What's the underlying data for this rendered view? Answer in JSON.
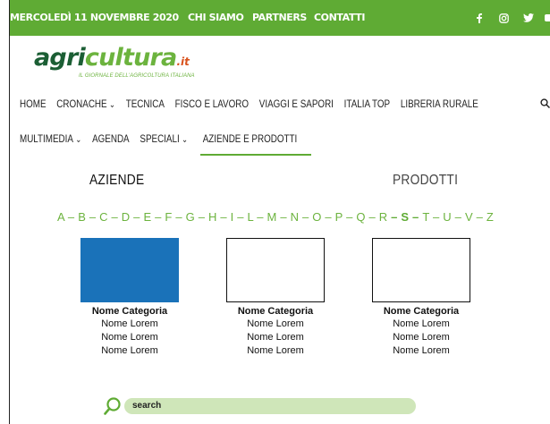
{
  "topbar": {
    "date": "MERCOLEDÌ 11 NOVEMBRE 2020",
    "links": [
      "CHI SIAMO",
      "PARTNERS",
      "CONTATTI"
    ],
    "social_icons": [
      "facebook-icon",
      "instagram-icon",
      "twitter-icon",
      "youtube-icon"
    ],
    "background": "#5fab34"
  },
  "logo": {
    "word_part1": "agri",
    "word_part2": "cultura",
    "suffix": ".it",
    "tagline": "IL GIORNALE DELL'AGRICOLTURA ITALIANA"
  },
  "nav": {
    "row1": [
      {
        "label": "HOME",
        "dropdown": false
      },
      {
        "label": "CRONACHE",
        "dropdown": true
      },
      {
        "label": "TECNICA",
        "dropdown": false
      },
      {
        "label": "FISCO E LAVORO",
        "dropdown": false
      },
      {
        "label": "VIAGGI E SAPORI",
        "dropdown": false
      },
      {
        "label": "ITALIA TOP",
        "dropdown": false
      },
      {
        "label": "LIBRERIA RURALE",
        "dropdown": false
      }
    ],
    "row2": [
      {
        "label": "MULTIMEDIA",
        "dropdown": true
      },
      {
        "label": "AGENDA",
        "dropdown": false
      },
      {
        "label": "SPECIALI",
        "dropdown": true
      },
      {
        "label": "AZIENDE E PRODOTTI",
        "dropdown": false
      }
    ],
    "search_icon": "search-icon",
    "active": "AZIENDE E PRODOTTI",
    "accent": "#5fab34"
  },
  "tabs": {
    "aziende": "AZIENDE",
    "prodotti": "PRODOTTI"
  },
  "alphabet": {
    "letters": [
      "A",
      "B",
      "C",
      "D",
      "E",
      "F",
      "G",
      "H",
      "I",
      "L",
      "M",
      "N",
      "O",
      "P",
      "Q",
      "R",
      "S",
      "T",
      "U",
      "V",
      "Z"
    ],
    "selected": "S",
    "color": "#6cb33e"
  },
  "cards": [
    {
      "category": "Nome Categoria",
      "lines": [
        "Nome Lorem",
        "Nome Lorem",
        "Nome Lorem"
      ],
      "thumb_color": "#1a72b9"
    },
    {
      "category": "Nome Categoria",
      "lines": [
        "Nome Lorem",
        "Nome Lorem",
        "Nome Lorem"
      ],
      "thumb_color": "#ffffff"
    },
    {
      "category": "Nome Categoria",
      "lines": [
        "Nome Lorem",
        "Nome Lorem",
        "Nome Lorem"
      ],
      "thumb_color": "#ffffff"
    }
  ],
  "search": {
    "placeholder": "search",
    "background": "#cfe6b9"
  }
}
